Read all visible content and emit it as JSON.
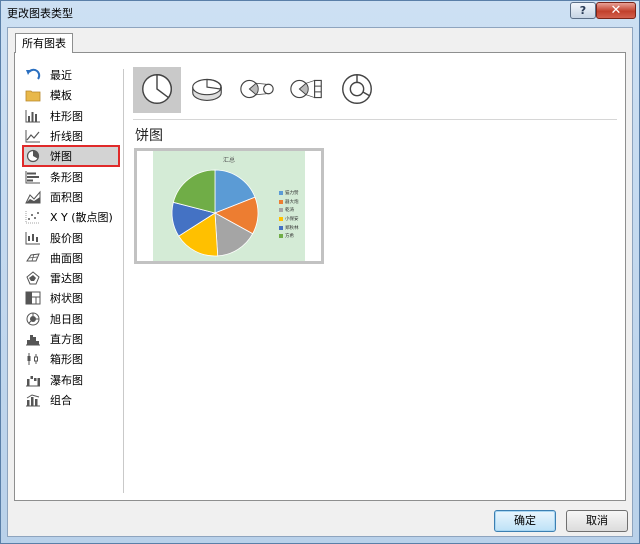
{
  "window": {
    "title": "更改图表类型",
    "help_label": "?",
    "close_label": "✕"
  },
  "tab": {
    "label": "所有图表"
  },
  "sidebar": {
    "items": [
      {
        "label": "最近",
        "icon": "recent-arrow-icon"
      },
      {
        "label": "模板",
        "icon": "folder-icon"
      },
      {
        "label": "柱形图",
        "icon": "column-chart-icon"
      },
      {
        "label": "折线图",
        "icon": "line-chart-icon"
      },
      {
        "label": "饼图",
        "icon": "pie-chart-icon"
      },
      {
        "label": "条形图",
        "icon": "bar-chart-icon"
      },
      {
        "label": "面积图",
        "icon": "area-chart-icon"
      },
      {
        "label": "X Y (散点图)",
        "icon": "scatter-chart-icon"
      },
      {
        "label": "股价图",
        "icon": "stock-chart-icon"
      },
      {
        "label": "曲面图",
        "icon": "surface-chart-icon"
      },
      {
        "label": "雷达图",
        "icon": "radar-chart-icon"
      },
      {
        "label": "树状图",
        "icon": "treemap-chart-icon"
      },
      {
        "label": "旭日图",
        "icon": "sunburst-chart-icon"
      },
      {
        "label": "直方图",
        "icon": "histogram-chart-icon"
      },
      {
        "label": "箱形图",
        "icon": "box-whisker-chart-icon"
      },
      {
        "label": "瀑布图",
        "icon": "waterfall-chart-icon"
      },
      {
        "label": "组合",
        "icon": "combo-chart-icon"
      }
    ],
    "selected_index": 4
  },
  "subtypes": [
    {
      "icon": "pie-icon",
      "selected": true
    },
    {
      "icon": "3d-pie-icon",
      "selected": false
    },
    {
      "icon": "pie-of-pie-icon",
      "selected": false
    },
    {
      "icon": "bar-of-pie-icon",
      "selected": false
    },
    {
      "icon": "doughnut-icon",
      "selected": false
    }
  ],
  "section_title": "饼图",
  "preview": {
    "title": "汇总",
    "legend": [
      {
        "label": "猫力赞",
        "color": "#5b9bd5"
      },
      {
        "label": "器大炮",
        "color": "#ed7d31"
      },
      {
        "label": "乾涛",
        "color": "#a5a5a5"
      },
      {
        "label": "小保安",
        "color": "#ffc000"
      },
      {
        "label": "郑秋林",
        "color": "#4472c4"
      },
      {
        "label": "方希",
        "color": "#70ad47"
      }
    ]
  },
  "chart_data": {
    "type": "pie",
    "title": "汇总",
    "categories": [
      "猫力赞",
      "器大炮",
      "乾涛",
      "小保安",
      "郑秋林",
      "方希"
    ],
    "values": [
      19,
      14,
      16,
      17,
      13,
      21
    ],
    "colors": [
      "#5b9bd5",
      "#ed7d31",
      "#a5a5a5",
      "#ffc000",
      "#4472c4",
      "#70ad47"
    ],
    "legend_position": "right"
  },
  "buttons": {
    "ok_label": "确定",
    "cancel_label": "取消"
  }
}
